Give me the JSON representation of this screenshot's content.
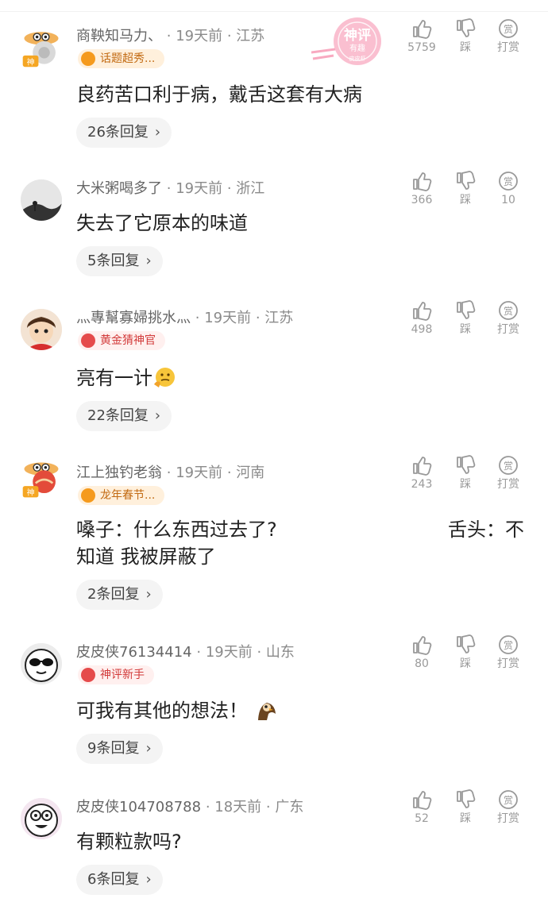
{
  "colors": {
    "meta_gray": "#8a8a8a",
    "badge_orange_bg": "#fff0dc",
    "badge_orange_text": "#c26a12",
    "badge_red_bg": "#fff0ef",
    "badge_red_text": "#d23a3a",
    "reply_bg": "#f4f4f4",
    "stamp_pink": "#f27aa0"
  },
  "watermark": {
    "text": "神评",
    "sub": "有趣",
    "tiny": "皮皮虾"
  },
  "comments": [
    {
      "user": "商鞅知马力、",
      "time": "19天前",
      "location": "江苏",
      "badge": "话题超秀...",
      "badge_style": "orange",
      "text": "良药苦口利于病，戴舌这套有大病",
      "replies": "26条回复",
      "likes": "5759",
      "dislike": "踩",
      "tip": "打赏"
    },
    {
      "user": "大米粥喝多了",
      "time": "19天前",
      "location": "浙江",
      "badge": "",
      "text": "失去了它原本的味道",
      "replies": "5条回复",
      "likes": "366",
      "dislike": "踩",
      "tip": "10"
    },
    {
      "user": "灬專幫寡婦挑水灬",
      "time": "19天前",
      "location": "江苏",
      "badge": "黄金猜神官",
      "badge_style": "red",
      "text": "亮有一计",
      "replies": "22条回复",
      "likes": "498",
      "dislike": "踩",
      "tip": "打赏"
    },
    {
      "user": "江上独钓老翁",
      "time": "19天前",
      "location": "河南",
      "badge": "龙年春节...",
      "badge_style": "orange",
      "text_line1": "嗓子：什么东西过去了?",
      "text_line1_right": "舌头：不",
      "text_line2": "知道 我被屏蔽了",
      "replies": "2条回复",
      "likes": "243",
      "dislike": "踩",
      "tip": "打赏"
    },
    {
      "user": "皮皮侠76134414",
      "time": "19天前",
      "location": "山东",
      "badge": "神评新手",
      "badge_style": "red",
      "text": "可我有其他的想法！",
      "replies": "9条回复",
      "likes": "80",
      "dislike": "踩",
      "tip": "打赏"
    },
    {
      "user": "皮皮侠104708788",
      "time": "18天前",
      "location": "广东",
      "badge": "",
      "text": "有颗粒款吗?",
      "replies": "6条回复",
      "likes": "52",
      "dislike": "踩",
      "tip": "打赏"
    }
  ]
}
